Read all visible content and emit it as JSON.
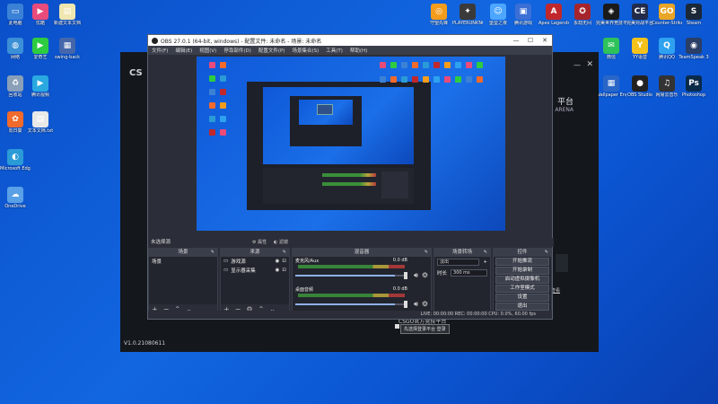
{
  "desktop": {
    "left_icons": [
      {
        "label": "此电脑",
        "color": "#3b82d6",
        "glyph": "▭"
      },
      {
        "label": "优酷",
        "color": "#e94b7a",
        "glyph": "▶"
      },
      {
        "label": "新建文本文档",
        "color": "#f0e6b0",
        "glyph": "▤"
      },
      {
        "label": "网络",
        "color": "#3b8fd6",
        "glyph": "◍"
      },
      {
        "label": "爱奇艺",
        "color": "#2ecc40",
        "glyph": "▶"
      },
      {
        "label": "swing-back",
        "color": "#4466aa",
        "glyph": "▦"
      },
      {
        "label": "回收站",
        "color": "#8aa0b8",
        "glyph": "♻"
      },
      {
        "label": "腾讯视频",
        "color": "#2aa9e0",
        "glyph": "▶"
      },
      {
        "label": "向日葵",
        "color": "#f26a2c",
        "glyph": "✿"
      },
      {
        "label": "文本文档.txt",
        "color": "#e8e8e8",
        "glyph": "▤"
      },
      {
        "label": "Microsoft Edge",
        "color": "#2a9bd6",
        "glyph": "◐"
      },
      {
        "label": "OneDrive",
        "color": "#5aa0e6",
        "glyph": "☁"
      }
    ],
    "top_icons": [
      {
        "label": "守望先锋",
        "color": "#f59c1c",
        "glyph": "◎"
      },
      {
        "label": "PLAYERUNKNOWN'S BATTLEGR...",
        "color": "#3a3a3a",
        "glyph": "✦"
      },
      {
        "label": "堡垒之夜",
        "color": "#4da6ff",
        "glyph": "☺"
      },
      {
        "label": "腾讯游戏",
        "color": "#3b6fd6",
        "glyph": "▣"
      },
      {
        "label": "Apex Legends",
        "color": "#c0282c",
        "glyph": "A"
      },
      {
        "label": "永劫无间",
        "color": "#a6252c",
        "glyph": "✪"
      },
      {
        "label": "完美世界竞技平台",
        "color": "#1a1a1a",
        "glyph": "◈"
      },
      {
        "label": "完美对战平台",
        "color": "#222b4a",
        "glyph": "CE"
      },
      {
        "label": "Counter-Strike Global Offe...",
        "color": "#e9a526",
        "glyph": "GO"
      },
      {
        "label": "Steam",
        "color": "#1b2838",
        "glyph": "S"
      }
    ],
    "right_icons": [
      {
        "label": "微信",
        "color": "#2ec25a",
        "glyph": "✉"
      },
      {
        "label": "YY语音",
        "color": "#f4c21b",
        "glyph": "Y"
      },
      {
        "label": "腾讯QQ",
        "color": "#2ea2f0",
        "glyph": "Q"
      },
      {
        "label": "TeamSpeak 3",
        "color": "#2a3e66",
        "glyph": "◉"
      },
      {
        "label": "Wallpaper Engine",
        "color": "#2a66c8",
        "glyph": "▦"
      },
      {
        "label": "OBS Studio",
        "color": "#222",
        "glyph": "●"
      },
      {
        "label": "网易云音乐",
        "color": "#333",
        "glyph": "♫"
      },
      {
        "label": "Photoshop",
        "color": "#0a2a4a",
        "glyph": "Ps"
      }
    ]
  },
  "launcher": {
    "logo": "CS",
    "title_main": "平台",
    "title_sub": "ARENA",
    "brand": "CSGO官方竞技平台",
    "auto_login": "先选择登录平台",
    "login_btn": "登录",
    "version": "V1.0.21080611",
    "side_link": "查看"
  },
  "obs": {
    "window_title": "OBS 27.0.1 (64-bit, windows) - 配置文件: 未命名 - 场景: 未命名",
    "menu": [
      "文件(F)",
      "编辑(E)",
      "视图(V)",
      "停靠部件(D)",
      "配置文件(P)",
      "场景集合(S)",
      "工具(T)",
      "帮助(H)"
    ],
    "scene_header": "未选择源",
    "toggle_props": "属性",
    "toggle_filters": "滤镜",
    "docks": {
      "scenes": {
        "title": "场景",
        "items": [
          "场景"
        ]
      },
      "sources": {
        "title": "来源",
        "items": [
          "游戏源",
          "显示器采集"
        ]
      },
      "mixer": {
        "title": "混音器",
        "channels": [
          {
            "name": "麦克风/Aux",
            "db": "0.0 dB",
            "level": 0.9
          },
          {
            "name": "桌面音频",
            "db": "0.0 dB",
            "level": 0.9
          }
        ]
      },
      "transitions": {
        "title": "场景转场",
        "type": "淡出",
        "duration_label": "时长",
        "duration": "300 ms"
      },
      "controls": {
        "title": "控件",
        "buttons": [
          "开始推流",
          "开始录制",
          "启动虚拟摄像机",
          "工作室模式",
          "设置",
          "退出"
        ]
      }
    },
    "status": "LIVE: 00:00:00   REC: 00:00:00   CPU: 0.0%, 60.00 fps"
  }
}
